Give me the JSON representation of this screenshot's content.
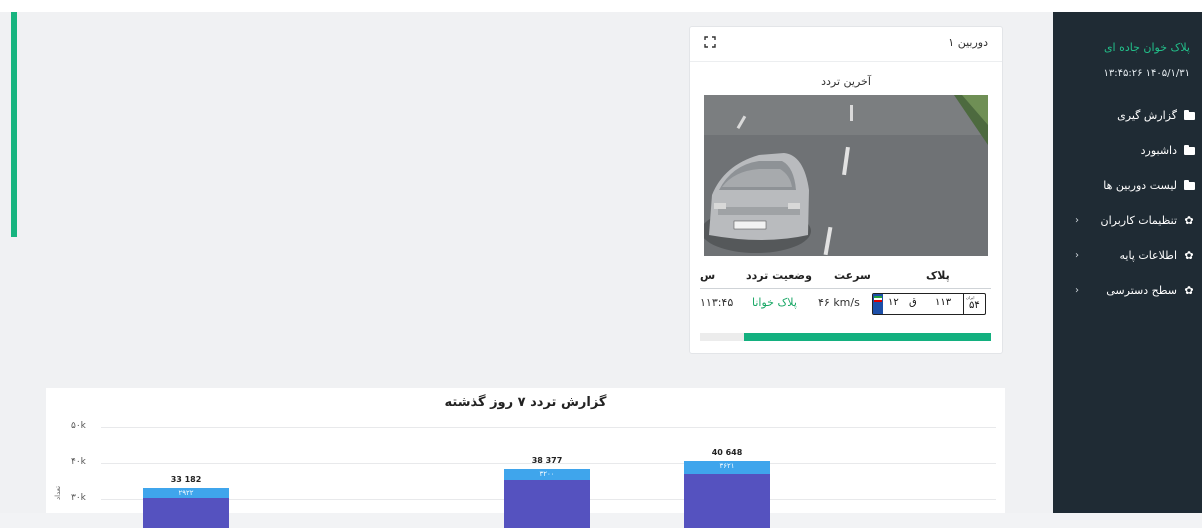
{
  "sidebar": {
    "brand": "پلاک خوان جاده ای",
    "datetime": "۱۴۰۵/۱/۳۱ ۱۳:۴۵:۲۶",
    "items": [
      {
        "label": "گزارش گیری",
        "icon": "folder-icon",
        "chevron": false
      },
      {
        "label": "داشبورد",
        "icon": "folder-icon",
        "chevron": false
      },
      {
        "label": "لیست دوربین ها",
        "icon": "folder-icon",
        "chevron": false
      },
      {
        "label": "تنظیمات کاربران",
        "icon": "gear-icon",
        "chevron": true
      },
      {
        "label": "اطلاعات پایه",
        "icon": "gear-icon",
        "chevron": true
      },
      {
        "label": "سطح دسترسی",
        "icon": "gear-icon",
        "chevron": true
      }
    ]
  },
  "camera": {
    "title": "دوربین ۱",
    "last_passage_label": "آخرین تردد",
    "table": {
      "headers": {
        "plate": "پلاک",
        "speed": "سرعت",
        "status": "وضعیت تردد",
        "time": "س"
      },
      "row": {
        "plate": {
          "region": "۵۴",
          "num3": "۱۱۳",
          "letter": "ق",
          "num2": "۱۲",
          "iran_label": "ایران"
        },
        "speed": "۴۶ km/s",
        "status": "پلاک خوانا",
        "time": "۱۱۳:۴۵"
      }
    },
    "progress_fraction": 0.85
  },
  "chart_data": {
    "type": "bar",
    "title": "گزارش تردد ۷ روز گذشته",
    "ylabel": "تعداد",
    "y_ticks": [
      "۵۰k",
      "۴۰k",
      "۳۰k"
    ],
    "ylim": [
      0,
      50000
    ],
    "series": [
      {
        "name": "",
        "values": [
          30260,
          35177,
          37027
        ]
      },
      {
        "name": "",
        "values": [
          2922,
          3200,
          3621
        ]
      }
    ],
    "totals": [
      "33 182",
      "38 377",
      "40 648"
    ],
    "segment_labels": [
      "۲۹۲۲",
      "۳۲۰۰",
      "۳۶۲۱"
    ],
    "colors": {
      "lower": "#5552bf",
      "upper": "#3fa5ec"
    }
  },
  "colors": {
    "accent": "#17b47f",
    "sidebar_bg": "#1f2b34",
    "brand": "#22c08a"
  }
}
